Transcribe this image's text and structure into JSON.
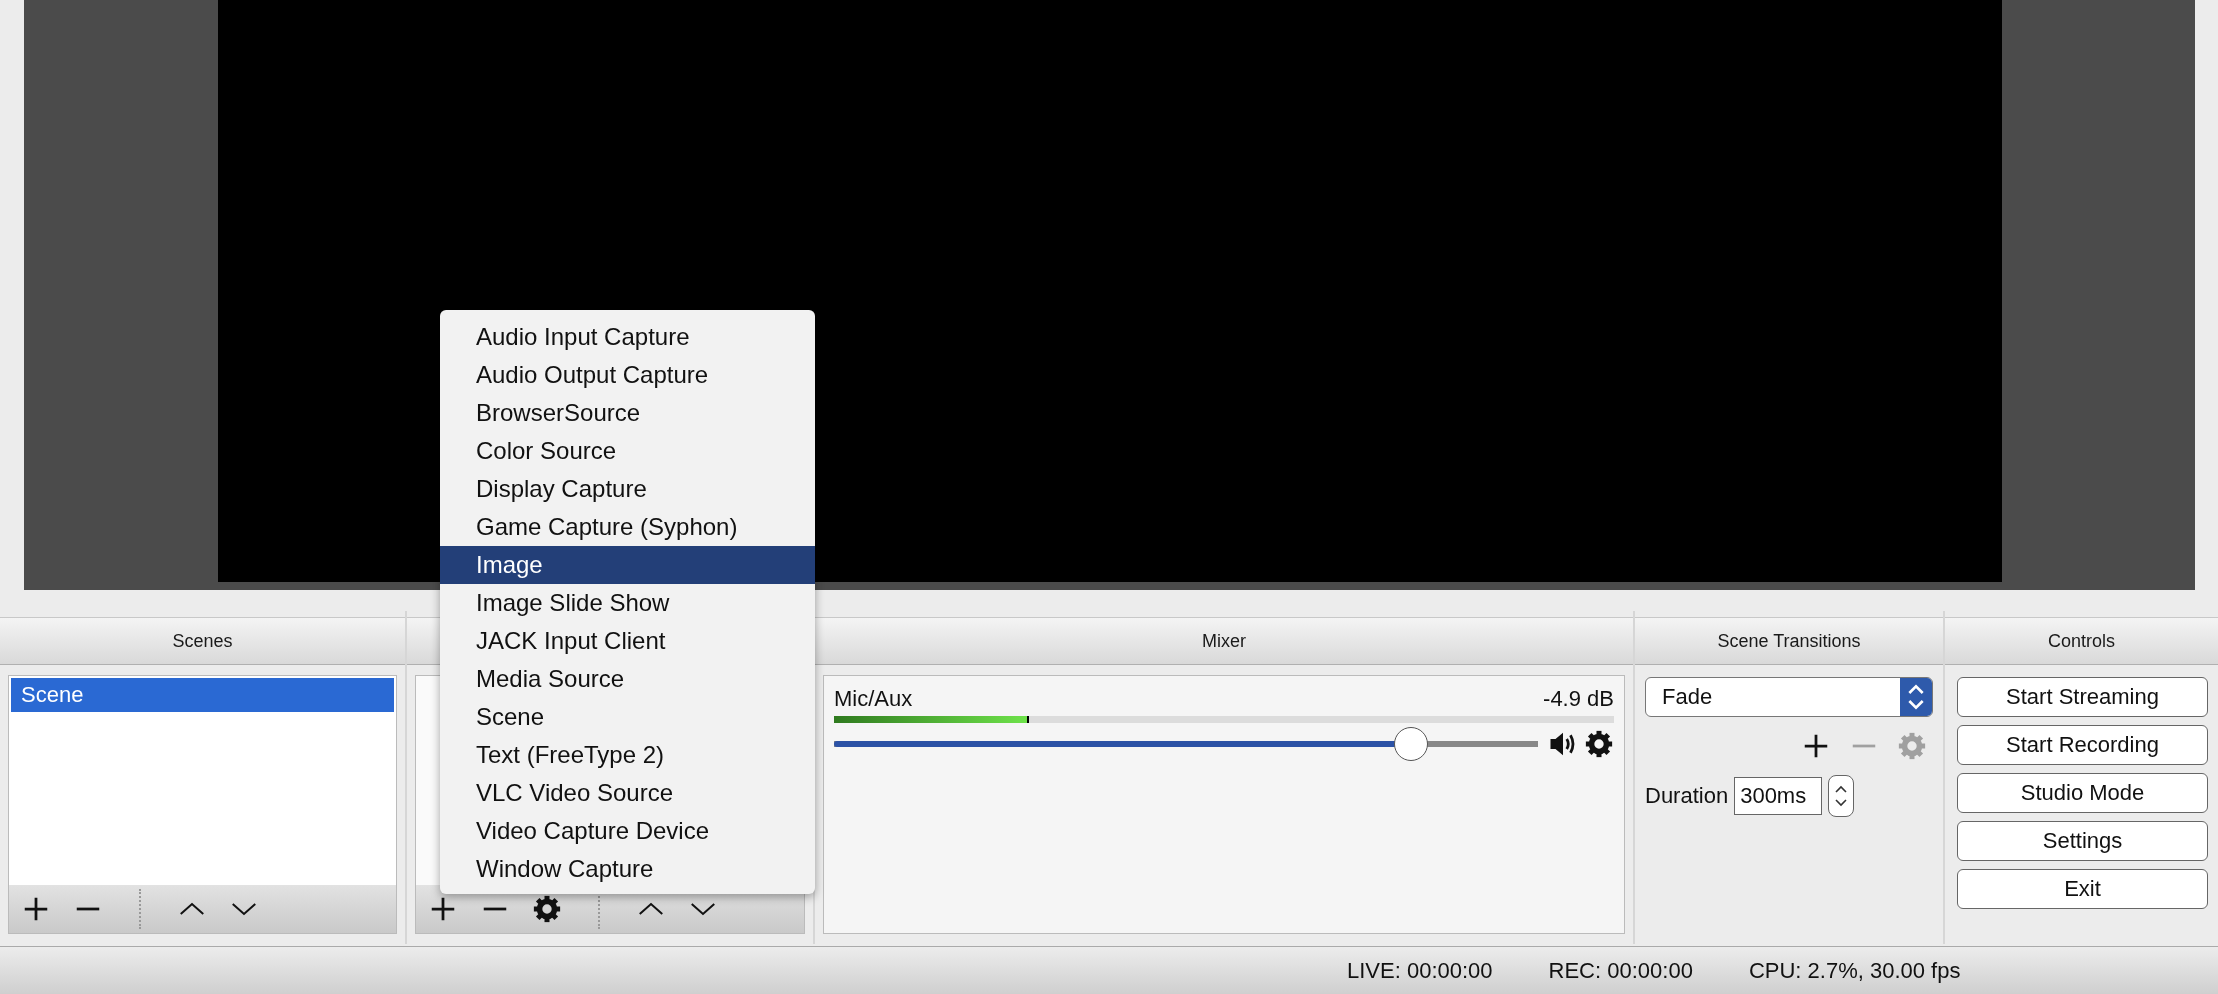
{
  "scenes": {
    "title": "Scenes",
    "items": [
      {
        "label": "Scene",
        "selected": true
      }
    ],
    "toolbar": [
      {
        "kind": "add"
      },
      {
        "kind": "remove"
      },
      {
        "kind": "separator"
      },
      {
        "kind": "up"
      },
      {
        "kind": "down"
      }
    ]
  },
  "sources": {
    "toolbar": [
      {
        "kind": "add"
      },
      {
        "kind": "remove"
      },
      {
        "kind": "settings"
      },
      {
        "kind": "separator"
      },
      {
        "kind": "up"
      },
      {
        "kind": "down"
      }
    ]
  },
  "mixer": {
    "title": "Mixer",
    "channels": [
      {
        "name": "Mic/Aux",
        "reading": "-4.9 dB",
        "meter": {
          "level": 0.25
        },
        "volume": {
          "level": 0.82
        }
      }
    ]
  },
  "transitions": {
    "title": "Scene Transitions",
    "transition": "Fade",
    "toolbar": [
      {
        "kind": "add",
        "disabled": false
      },
      {
        "kind": "remove",
        "disabled": true
      },
      {
        "kind": "settings",
        "disabled": true
      }
    ],
    "duration_label": "Duration",
    "duration": "300ms"
  },
  "controls": {
    "title": "Controls",
    "buttons": [
      "Start Streaming",
      "Start Recording",
      "Studio Mode",
      "Settings",
      "Exit"
    ]
  },
  "status_bar": {
    "items": [
      "LIVE: 00:00:00",
      "REC: 00:00:00",
      "CPU: 2.7%, 30.00 fps"
    ]
  },
  "add_source_menu": {
    "items": [
      {
        "label": "Audio Input Capture",
        "selected": false
      },
      {
        "label": "Audio Output Capture",
        "selected": false
      },
      {
        "label": "BrowserSource",
        "selected": false
      },
      {
        "label": "Color Source",
        "selected": false
      },
      {
        "label": "Display Capture",
        "selected": false
      },
      {
        "label": "Game Capture (Syphon)",
        "selected": false
      },
      {
        "label": "Image",
        "selected": true
      },
      {
        "label": "Image Slide Show",
        "selected": false
      },
      {
        "label": "JACK Input Client",
        "selected": false
      },
      {
        "label": "Media Source",
        "selected": false
      },
      {
        "label": "Scene",
        "selected": false
      },
      {
        "label": "Text (FreeType 2)",
        "selected": false
      },
      {
        "label": "VLC Video Source",
        "selected": false
      },
      {
        "label": "Video Capture Device",
        "selected": false
      },
      {
        "label": "Window Capture",
        "selected": false
      }
    ]
  }
}
